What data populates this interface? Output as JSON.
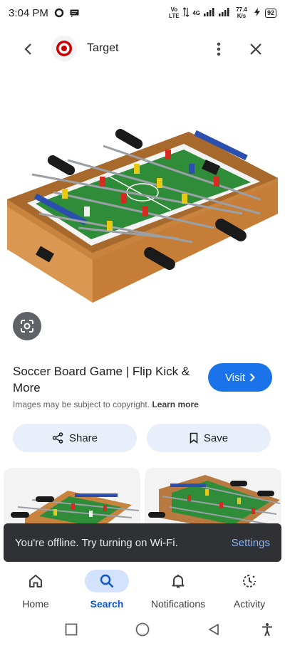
{
  "status_bar": {
    "time": "3:04 PM",
    "volte": "Vo LTE",
    "network": "4G",
    "speed": "77.4 K/s",
    "battery": "92"
  },
  "header": {
    "site_name": "Target"
  },
  "product": {
    "title": "Soccer Board Game | Flip Kick & More",
    "visit_label": "Visit",
    "copyright_text": "Images may be subject to copyright.",
    "learn_more": "Learn more"
  },
  "actions": {
    "share_label": "Share",
    "save_label": "Save"
  },
  "snackbar": {
    "message": "You're offline. Try turning on Wi-Fi.",
    "action": "Settings"
  },
  "bottom_nav": {
    "items": [
      {
        "label": "Home",
        "icon": "home-icon",
        "active": false
      },
      {
        "label": "Search",
        "icon": "search-icon",
        "active": true
      },
      {
        "label": "Notifications",
        "icon": "bell-icon",
        "active": false
      },
      {
        "label": "Activity",
        "icon": "activity-icon",
        "active": false
      }
    ]
  },
  "colors": {
    "accent": "#1a73e8",
    "active_nav": "#0b57d0",
    "snackbar_bg": "#303134",
    "snackbar_action": "#8ab4f8"
  }
}
